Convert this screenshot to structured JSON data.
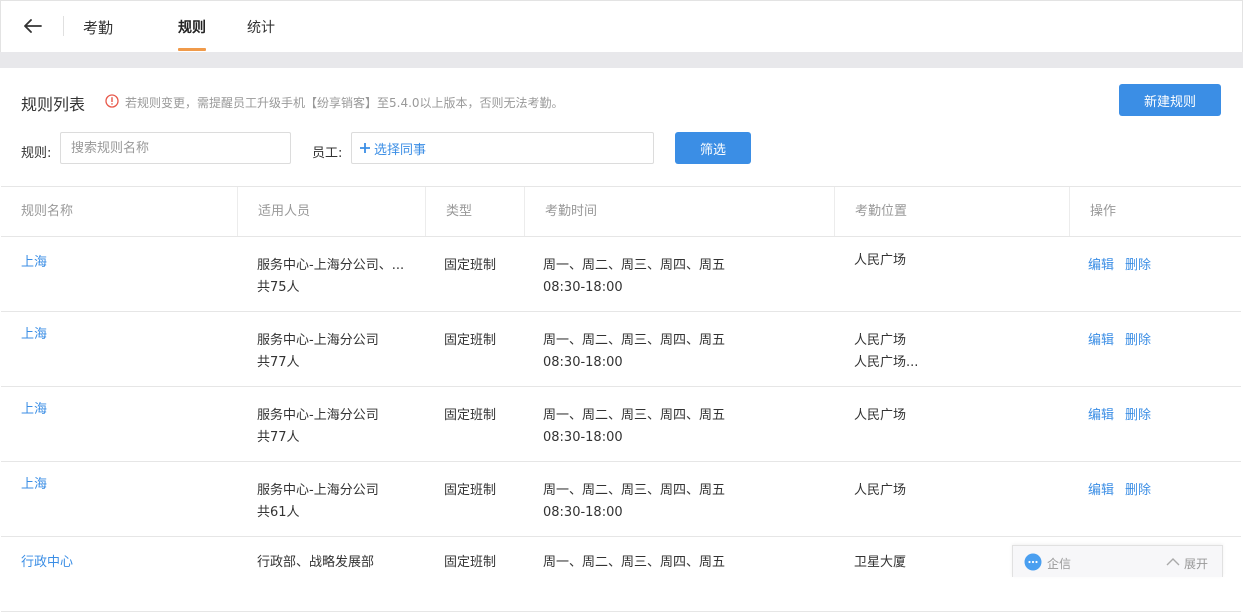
{
  "nav": {
    "app_title": "考勤",
    "tabs": [
      {
        "label": "规则",
        "active": true
      },
      {
        "label": "统计",
        "active": false
      }
    ]
  },
  "header": {
    "title": "规则列表",
    "warning": "若规则变更，需提醒员工升级手机【纷享销客】至5.4.0以上版本，否则无法考勤。",
    "new_rule_label": "新建规则"
  },
  "filters": {
    "rule_label": "规则:",
    "rule_placeholder": "搜索规则名称",
    "staff_label": "员工:",
    "staff_picker_text": "选择同事",
    "filter_button": "筛选"
  },
  "table": {
    "columns": [
      "规则名称",
      "适用人员",
      "类型",
      "考勤时间",
      "考勤位置",
      "操作"
    ],
    "rows": [
      {
        "name": "上海",
        "staff": "服务中心-上海分公司、...",
        "count": "共75人",
        "type": "固定班制",
        "days": "周一、周二、周三、周四、周五",
        "hours": "08:30-18:00",
        "loc1": "人民广场",
        "loc2": "",
        "edit": "编辑",
        "del": "删除"
      },
      {
        "name": "上海",
        "staff": "服务中心-上海分公司",
        "count": "共77人",
        "type": "固定班制",
        "days": "周一、周二、周三、周四、周五",
        "hours": "08:30-18:00",
        "loc1": "人民广场",
        "loc2": "人民广场...",
        "edit": "编辑",
        "del": "删除"
      },
      {
        "name": "上海",
        "staff": "服务中心-上海分公司",
        "count": "共77人",
        "type": "固定班制",
        "days": "周一、周二、周三、周四、周五",
        "hours": "08:30-18:00",
        "loc1": "人民广场",
        "loc2": "",
        "edit": "编辑",
        "del": "删除"
      },
      {
        "name": "上海",
        "staff": "服务中心-上海分公司",
        "count": "共61人",
        "type": "固定班制",
        "days": "周一、周二、周三、周四、周五",
        "hours": "08:30-18:00",
        "loc1": "人民广场",
        "loc2": "",
        "edit": "编辑",
        "del": "删除"
      },
      {
        "name": "行政中心",
        "staff": "行政部、战略发展部",
        "count": "",
        "type": "固定班制",
        "days": "周一、周二、周三、周四、周五",
        "hours": "",
        "loc1": "卫星大厦",
        "loc2": "",
        "edit": "",
        "del": ""
      }
    ]
  },
  "chat": {
    "label": "企信",
    "expand": "展开"
  },
  "colors": {
    "accent": "#3b8ee5",
    "tab_indicator": "#f09a4a",
    "warning": "#e8594b"
  }
}
